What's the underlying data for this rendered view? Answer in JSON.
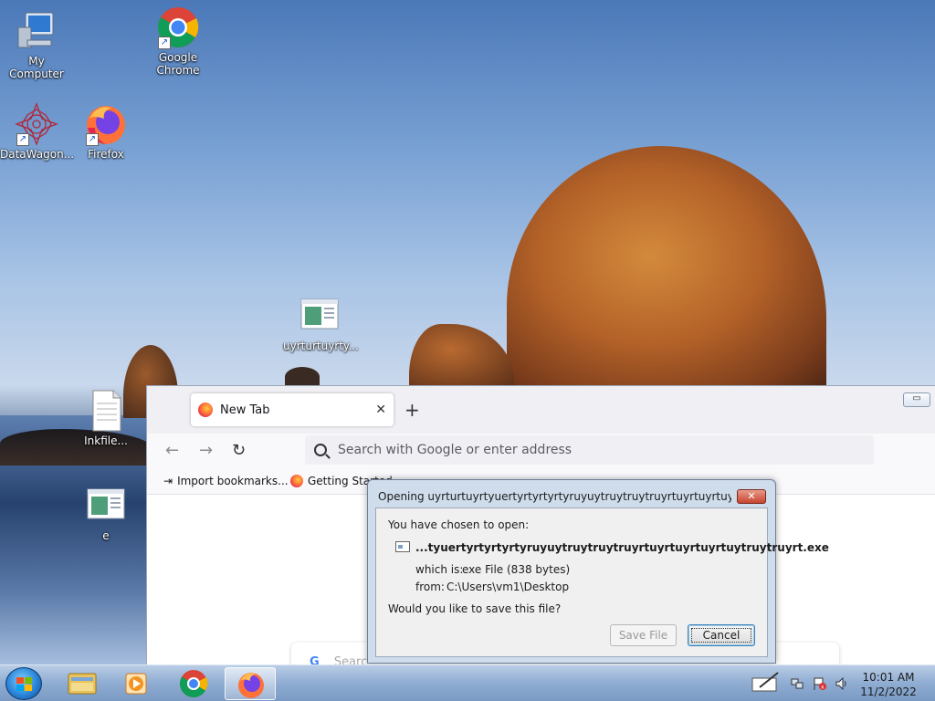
{
  "desktop": {
    "icons": [
      {
        "label": "My Computer",
        "icon": "computer-icon"
      },
      {
        "label": "Google Chrome",
        "icon": "chrome-icon"
      },
      {
        "label": "DataWagon...",
        "icon": "datawagon-icon"
      },
      {
        "label": "Firefox",
        "icon": "firefox-icon"
      },
      {
        "label": "uyrturtuyrty...",
        "icon": "exe-file-icon"
      },
      {
        "label": "Inkfile...",
        "icon": "document-icon"
      },
      {
        "label": "e",
        "icon": "exe-file-icon"
      }
    ]
  },
  "browser": {
    "tab_label": "New Tab",
    "tab_close": "✕",
    "new_tab": "+",
    "back": "←",
    "forward": "→",
    "reload": "↻",
    "minimize": "▭",
    "url_placeholder": "Search with Google or enter address",
    "bookmarks": [
      {
        "label": "Import bookmarks...",
        "icon": "import-icon"
      },
      {
        "label": "Getting Started",
        "icon": "firefox-icon"
      }
    ],
    "google_search_text": "Searc"
  },
  "dialog": {
    "title": "Opening uyrturtuyrtyuertyrtyrtyrtyruyuytruytruytruyrtuyrtuyrtuyrtuyrtuytruytr...",
    "close": "✕",
    "chosen_label": "You have chosen to open:",
    "filename": "...tyuertyrtyrtyrtyruyuytruytruytruyrtuyrtuyrtuyrtuytruytruyrt.exe",
    "which_is_label": "which is:",
    "which_is_value": "exe File (838 bytes)",
    "from_label": "from:",
    "from_value": "C:\\Users\\vm1\\Desktop",
    "question": "Would you like to save this file?",
    "save_button": "Save File",
    "cancel_button": "Cancel"
  },
  "taskbar": {
    "items": [
      "windows-explorer-icon",
      "media-player-icon",
      "chrome-icon",
      "firefox-icon"
    ],
    "active_item": "firefox-icon",
    "clock_time": "10:01 AM",
    "clock_date": "11/2/2022"
  }
}
